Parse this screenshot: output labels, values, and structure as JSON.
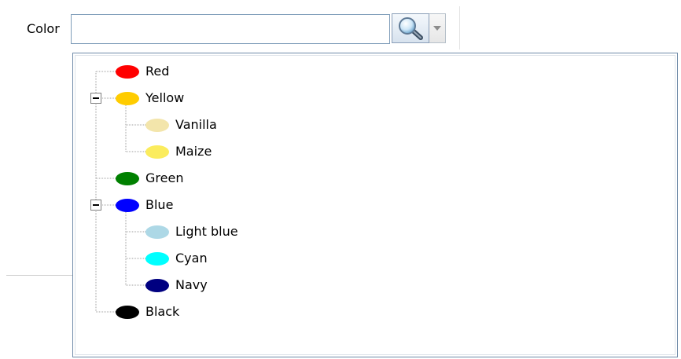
{
  "field": {
    "label": "Color",
    "value": ""
  },
  "search_button": {
    "icon": "magnifier-icon"
  },
  "dropdown_button": {
    "icon": "chevron-down-icon"
  },
  "tree": {
    "nodes": [
      {
        "label": "Red",
        "color": "#ff0000",
        "level": 0,
        "expanded": false
      },
      {
        "label": "Yellow",
        "color": "#ffcc00",
        "level": 0,
        "expanded": true
      },
      {
        "label": "Vanilla",
        "color": "#f3e5ab",
        "level": 1,
        "expanded": false
      },
      {
        "label": "Maize",
        "color": "#fbec5d",
        "level": 1,
        "expanded": false
      },
      {
        "label": "Green",
        "color": "#008000",
        "level": 0,
        "expanded": false
      },
      {
        "label": "Blue",
        "color": "#0000ff",
        "level": 0,
        "expanded": true
      },
      {
        "label": "Light blue",
        "color": "#add8e6",
        "level": 1,
        "expanded": false
      },
      {
        "label": "Cyan",
        "color": "#00ffff",
        "level": 1,
        "expanded": false
      },
      {
        "label": "Navy",
        "color": "#000080",
        "level": 1,
        "expanded": false
      },
      {
        "label": "Black",
        "color": "#000000",
        "level": 0,
        "expanded": false
      }
    ]
  }
}
